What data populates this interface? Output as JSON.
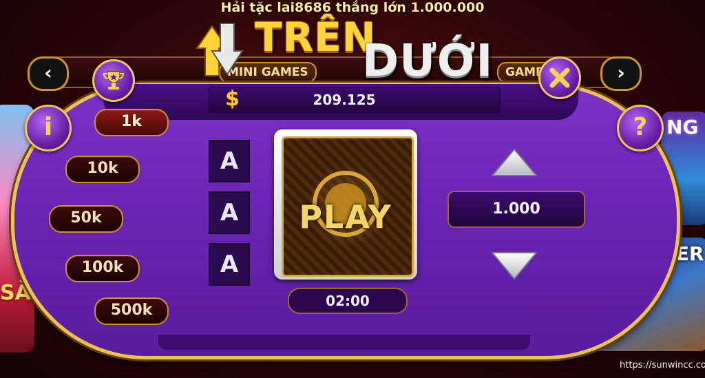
{
  "ticker": "Hải tặc lai8686 thắng lớn 1.000.000",
  "logo": {
    "top": "TRÊN",
    "bottom": "DƯỚI"
  },
  "lobby_nav": {
    "left_label": "MINI GAMES",
    "right_label": "GAMES"
  },
  "background_tiles": {
    "right_top_text": "NG",
    "right_bottom_text": "KER",
    "left_text": "SĂI"
  },
  "panel": {
    "currency_icon": "$",
    "balance": "209.125",
    "chips": [
      "1k",
      "10k",
      "50k",
      "100k",
      "500k"
    ],
    "active_chip": "1k",
    "history": [
      "A",
      "A",
      "A"
    ],
    "card_label": "PLAY",
    "timer": "02:00",
    "bet_amount": "1.000"
  },
  "buttons": {
    "info": "i",
    "help": "?",
    "prev": "‹",
    "next": "›"
  },
  "watermark": "https://sunwincc.com/",
  "colors": {
    "panel": "#6a24b3",
    "gold": "#e8c25a",
    "accent": "#ffd43b"
  }
}
